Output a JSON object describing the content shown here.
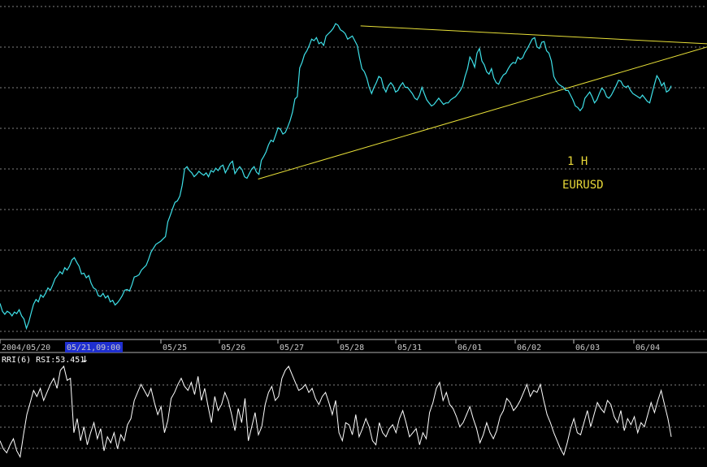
{
  "chart_data": [
    {
      "type": "line",
      "title": "",
      "annotations": {
        "timeframe": "1 H",
        "symbol": "EURUSD"
      },
      "x_ticks": [
        "2004/05/20",
        "05/21",
        "05/25",
        "05/26",
        "05/27",
        "05/28",
        "05/31",
        "06/01",
        "06/02",
        "06/03",
        "06/04"
      ],
      "cursor_label": "05/21,09:00",
      "ylim": [
        0,
        100
      ],
      "grid": true,
      "colors": {
        "price": "#3ee0e8",
        "trendlines": "#e8e038",
        "grid": "#808080",
        "cursor_bg": "#1f2fd0"
      },
      "series": [
        {
          "values": [
            38,
            28,
            24,
            28,
            26,
            22,
            27,
            25,
            30,
            22,
            18,
            6,
            14,
            26,
            37,
            43,
            40,
            49,
            46,
            51,
            58,
            55,
            62,
            70,
            74,
            79,
            76,
            84,
            81,
            86,
            94,
            97,
            91,
            86,
            76,
            77,
            71,
            74,
            64,
            58,
            56,
            48,
            47,
            51,
            45,
            48,
            40,
            42,
            36,
            39,
            43,
            48,
            55,
            56,
            54,
            62,
            72,
            73,
            75,
            81,
            84,
            87,
            95,
            104,
            109,
            114,
            116,
            118,
            121,
            124,
            143,
            151,
            160,
            168,
            170,
            176,
            190,
            211,
            214,
            209,
            206,
            201,
            204,
            208,
            205,
            203,
            206,
            201,
            209,
            207,
            212,
            209,
            214,
            216,
            206,
            212,
            218,
            221,
            205,
            210,
            214,
            210,
            201,
            199,
            205,
            211,
            214,
            207,
            204,
            222,
            227,
            233,
            242,
            248,
            246,
            255,
            264,
            262,
            256,
            258,
            265,
            273,
            284,
            301,
            304,
            341,
            348,
            358,
            363,
            370,
            378,
            376,
            380,
            372,
            374,
            370,
            382,
            385,
            388,
            392,
            398,
            396,
            390,
            388,
            385,
            378,
            380,
            382,
            376,
            370,
            354,
            340,
            336,
            328,
            316,
            308,
            316,
            322,
            330,
            328,
            316,
            310,
            318,
            322,
            318,
            310,
            312,
            318,
            322,
            316,
            316,
            312,
            308,
            302,
            300,
            306,
            316,
            308,
            300,
            296,
            292,
            294,
            298,
            302,
            298,
            294,
            296,
            296,
            300,
            302,
            304,
            308,
            312,
            318,
            330,
            340,
            355,
            350,
            342,
            360,
            366,
            350,
            345,
            336,
            333,
            340,
            328,
            322,
            320,
            327,
            332,
            334,
            340,
            345,
            348,
            347,
            355,
            352,
            354,
            361,
            366,
            372,
            378,
            380,
            368,
            366,
            374,
            375,
            363,
            360,
            350,
            330,
            324,
            320,
            318,
            316,
            312,
            312,
            306,
            300,
            292,
            290,
            286,
            290,
            302,
            306,
            310,
            304,
            296,
            300,
            308,
            315,
            312,
            304,
            302,
            306,
            312,
            318,
            325,
            324,
            318,
            316,
            318,
            312,
            308,
            306,
            304,
            302,
            306,
            302,
            298,
            296,
            308,
            320,
            331,
            326,
            318,
            322,
            310,
            312,
            318
          ],
          "ylim": [
            0,
            420
          ]
        }
      ],
      "trendlines": [
        {
          "from": [
            0.51,
            395
          ],
          "to": [
            1.0,
            372
          ]
        },
        {
          "from": [
            0.365,
            198
          ],
          "to": [
            1.0,
            368
          ]
        }
      ]
    },
    {
      "type": "line",
      "indicator_label": "RRI(6) RSI:53.451",
      "ylim": [
        0,
        100
      ],
      "grid": true,
      "colors": {
        "line": "#ffffff",
        "grid": "#808080"
      },
      "series": [
        {
          "values": [
            22,
            14,
            10,
            18,
            24,
            12,
            6,
            28,
            48,
            60,
            72,
            66,
            74,
            62,
            70,
            78,
            84,
            74,
            92,
            96,
            82,
            84,
            30,
            44,
            22,
            36,
            18,
            30,
            40,
            24,
            34,
            12,
            26,
            20,
            30,
            14,
            28,
            22,
            38,
            44,
            62,
            70,
            78,
            72,
            66,
            74,
            60,
            48,
            56,
            30,
            42,
            64,
            70,
            78,
            84,
            76,
            72,
            80,
            68,
            86,
            62,
            74,
            56,
            40,
            66,
            52,
            58,
            70,
            62,
            48,
            32,
            54,
            40,
            64,
            22,
            36,
            50,
            28,
            36,
            58,
            70,
            76,
            62,
            66,
            84,
            92,
            96,
            88,
            80,
            72,
            74,
            78,
            70,
            74,
            64,
            58,
            66,
            70,
            60,
            48,
            62,
            30,
            22,
            40,
            38,
            28,
            48,
            26,
            34,
            44,
            36,
            22,
            18,
            40,
            30,
            26,
            34,
            38,
            30,
            44,
            52,
            40,
            26,
            30,
            34,
            18,
            30,
            24,
            50,
            60,
            74,
            80,
            62,
            70,
            58,
            54,
            46,
            36,
            40,
            48,
            56,
            44,
            34,
            20,
            28,
            40,
            30,
            24,
            32,
            46,
            52,
            64,
            60,
            52,
            56,
            62,
            70,
            78,
            66,
            72,
            70,
            78,
            62,
            48,
            40,
            30,
            22,
            14,
            8,
            20,
            34,
            44,
            30,
            28,
            40,
            52,
            36,
            48,
            60,
            54,
            50,
            62,
            58,
            46,
            40,
            52,
            32,
            44,
            38,
            46,
            30,
            40,
            36,
            48,
            60,
            50,
            62,
            72,
            58,
            44,
            26
          ],
          "ylim": [
            0,
            100
          ]
        }
      ]
    }
  ]
}
